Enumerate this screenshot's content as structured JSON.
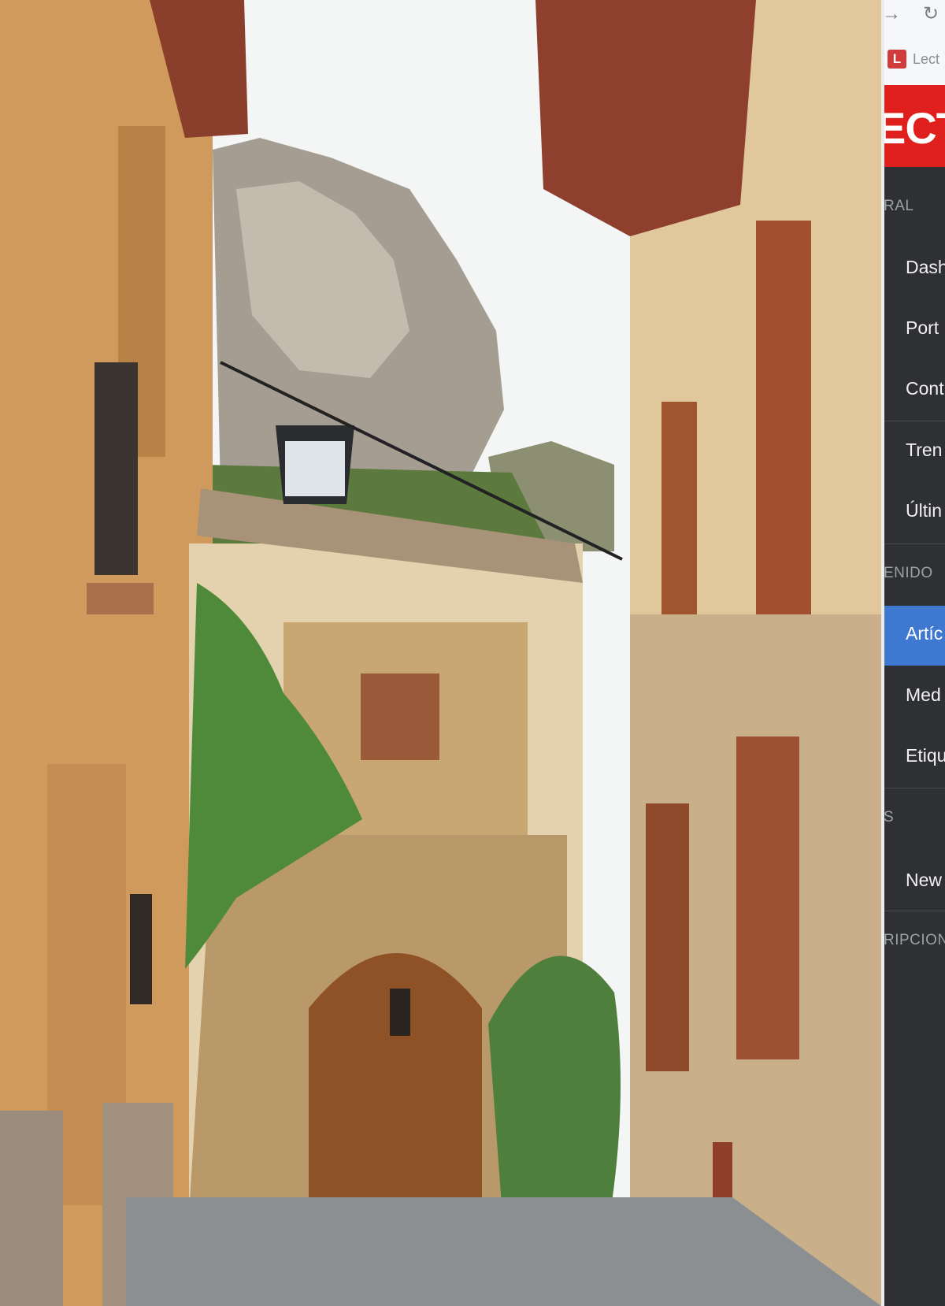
{
  "browser": {
    "nav_forward_icon": "arrow-right-icon",
    "nav_reload_icon": "reload-icon",
    "tab": {
      "favicon_letter": "L",
      "title": "Lect"
    }
  },
  "sidebar": {
    "brand": "ECTU",
    "sections": [
      {
        "label": "RAL",
        "items": [
          "Dash",
          "Port",
          "Cont"
        ]
      },
      {
        "label": "",
        "items": [
          "Tren",
          "Últin"
        ]
      },
      {
        "label": "ENIDO",
        "items": [
          "Artíc",
          "Med",
          "Etiqu"
        ],
        "active_index": 0
      },
      {
        "label": "S",
        "items": [
          "New"
        ]
      },
      {
        "label": "RIPCION",
        "items": []
      }
    ]
  },
  "colors": {
    "sidebar_bg": "#2f3033",
    "active_item": "#3f78d1",
    "brand_red": "#e0201c"
  }
}
